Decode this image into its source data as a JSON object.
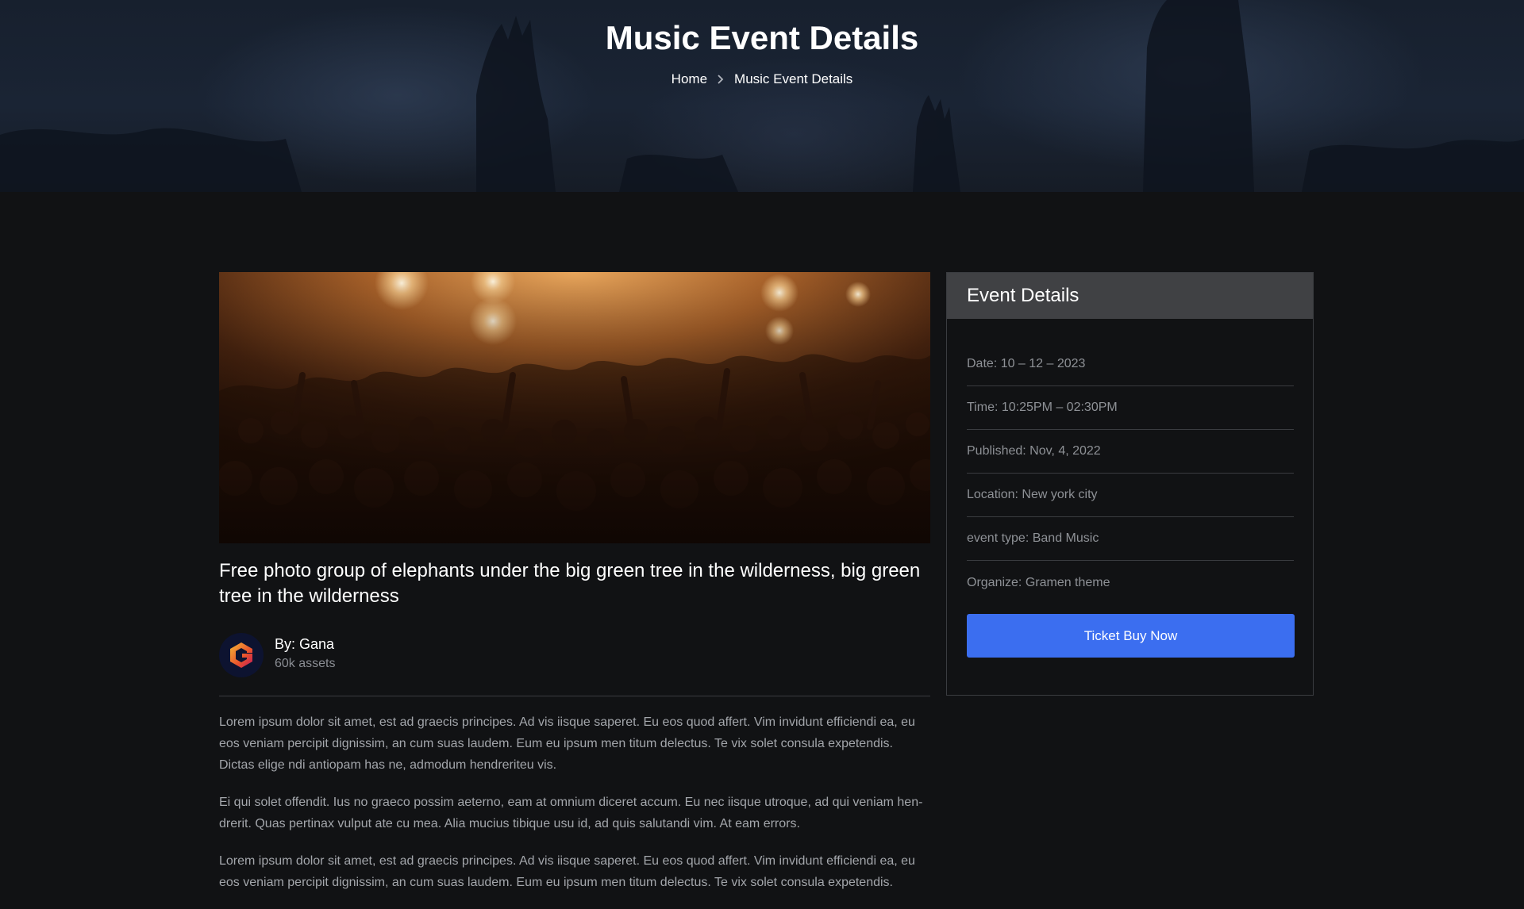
{
  "hero": {
    "title": "Music Event Details",
    "breadcrumb": {
      "home": "Home",
      "current": "Music Event Details"
    }
  },
  "post": {
    "title": "Free photo group of elephants under the big green tree in the wilderness, big green tree in the wilderness",
    "author": {
      "name": "By: Gana",
      "assets": "60k assets"
    },
    "paragraphs": [
      "Lorem ipsum dolor sit amet, est ad graecis principes. Ad vis iisque saperet. Eu eos quod affert. Vim invidunt efficiendi ea, eu eos veniam percipit dignissim, an cum suas laudem. Eum eu ipsum men titum delectus. Te vix solet consula expetendis. Dictas elige ndi antiopam has ne, admodum hendreriteu vis.",
      "Ei qui solet offendit. Ius no graeco possim aeterno, eam at omnium diceret accum. Eu nec iisque utroque, ad qui veniam hen-drerit. Quas pertinax vulput ate cu mea. Alia mucius tibique usu id, ad quis salutandi vim. At eam errors.",
      "Lorem ipsum dolor sit amet, est ad graecis principes. Ad vis iisque saperet. Eu eos quod affert. Vim invidunt efficiendi ea, eu eos veniam percipit dignissim, an cum suas laudem. Eum eu ipsum men titum delectus. Te vix solet consula expetendis."
    ]
  },
  "sidebar": {
    "title": "Event Details",
    "items": [
      "Date: 10 – 12 – 2023",
      "Time: 10:25PM – 02:30PM",
      "Published: Nov, 4, 2022",
      "Location: New york city",
      "event type: Band Music",
      "Organize: Gramen theme"
    ],
    "button_label": "Ticket Buy Now"
  },
  "colors": {
    "background": "#111214",
    "accent": "#3b6ef0",
    "card_header": "#404144",
    "muted_text": "#8e9196"
  },
  "icons": {
    "breadcrumb_separator": "chevron-right-icon",
    "avatar": "author-logo-icon"
  }
}
